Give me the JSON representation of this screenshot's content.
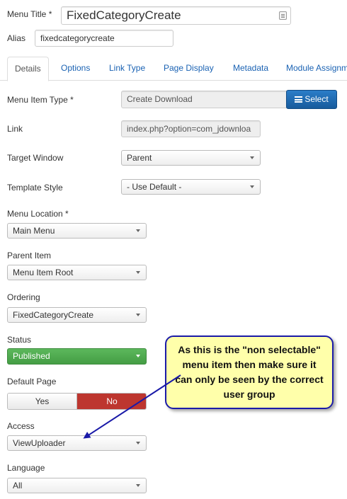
{
  "header": {
    "menu_title_label": "Menu Title *",
    "menu_title_value": "FixedCategoryCreate",
    "alias_label": "Alias",
    "alias_value": "fixedcategorycreate"
  },
  "tabs": [
    {
      "label": "Details",
      "active": true
    },
    {
      "label": "Options"
    },
    {
      "label": "Link Type"
    },
    {
      "label": "Page Display"
    },
    {
      "label": "Metadata"
    },
    {
      "label": "Module Assignm"
    }
  ],
  "form": {
    "menu_item_type": {
      "label": "Menu Item Type *",
      "value": "Create Download",
      "button": "Select"
    },
    "link": {
      "label": "Link",
      "value": "index.php?option=com_jdownloa"
    },
    "target_window": {
      "label": "Target Window",
      "value": "Parent"
    },
    "template_style": {
      "label": "Template Style",
      "value": "- Use Default -"
    },
    "menu_location": {
      "label": "Menu Location *",
      "value": "Main Menu"
    },
    "parent_item": {
      "label": "Parent Item",
      "value": "Menu Item Root"
    },
    "ordering": {
      "label": "Ordering",
      "value": "FixedCategoryCreate"
    },
    "status": {
      "label": "Status",
      "value": "Published"
    },
    "default_page": {
      "label": "Default Page",
      "yes": "Yes",
      "no": "No"
    },
    "access": {
      "label": "Access",
      "value": "ViewUploader"
    },
    "language": {
      "label": "Language",
      "value": "All"
    }
  },
  "callout": {
    "text": "As this is the \"non selectable\" menu item then make sure it can only be seen by the correct user group"
  },
  "colors": {
    "link_blue": "#1a62b3",
    "select_button": "#1f6fb5",
    "status_green": "#51a351",
    "no_red": "#bd362f",
    "callout_bg": "#ffffaa",
    "callout_border": "#1a1aa8"
  }
}
